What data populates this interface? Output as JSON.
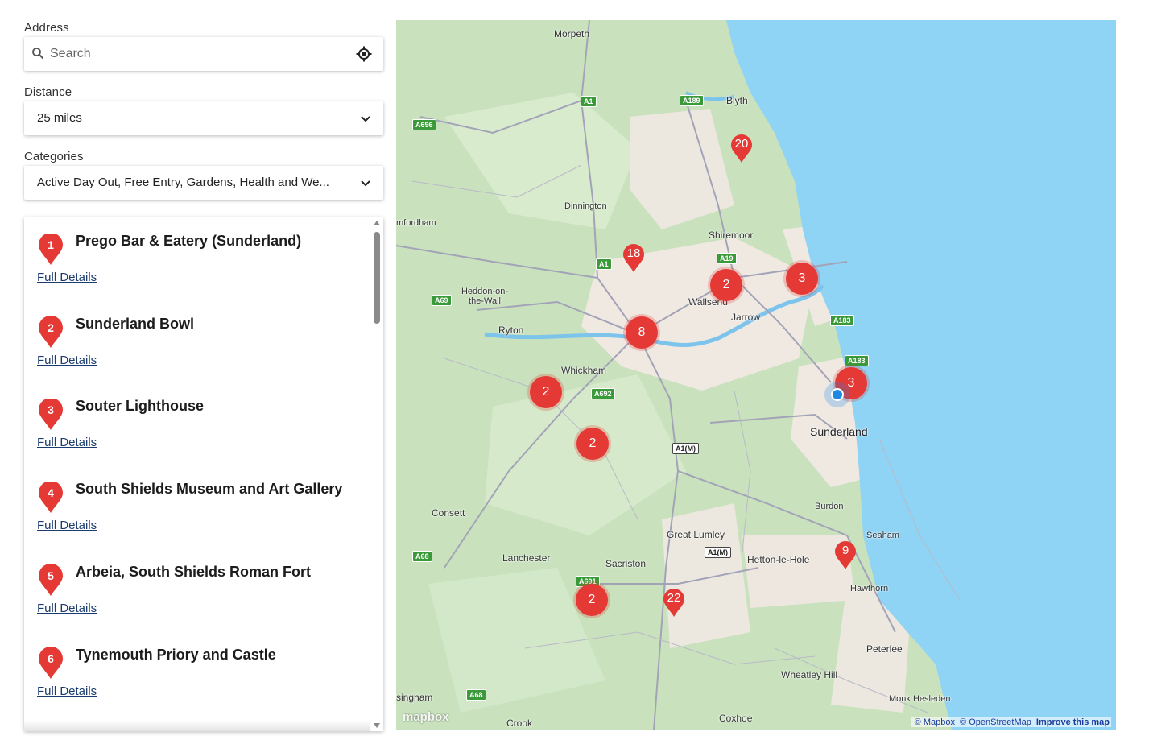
{
  "address": {
    "label": "Address",
    "placeholder": "Search"
  },
  "distance": {
    "label": "Distance",
    "value": "25 miles"
  },
  "categories": {
    "label": "Categories",
    "value": "Active Day Out, Free Entry, Gardens, Health and We..."
  },
  "results": [
    {
      "number": "1",
      "title": "Prego Bar & Eatery (Sunderland)",
      "link": "Full Details"
    },
    {
      "number": "2",
      "title": "Sunderland Bowl",
      "link": "Full Details"
    },
    {
      "number": "3",
      "title": "Souter Lighthouse",
      "link": "Full Details"
    },
    {
      "number": "4",
      "title": "South Shields Museum and Art Gallery",
      "link": "Full Details"
    },
    {
      "number": "5",
      "title": "Arbeia, South Shields Roman Fort",
      "link": "Full Details"
    },
    {
      "number": "6",
      "title": "Tynemouth Priory and Castle",
      "link": "Full Details"
    }
  ],
  "map": {
    "places": [
      "Morpeth",
      "Blyth",
      "Dinnington",
      "Shiremoor",
      "mfordham",
      "Heddon-on-the-Wall",
      "Wallsend",
      "Jarrow",
      "Ryton",
      "Whickham",
      "Sunderland",
      "Consett",
      "Burdon",
      "Great Lumley",
      "Seaham",
      "Lanchester",
      "Sacriston",
      "Hetton-le-Hole",
      "Hawthorn",
      "Peterlee",
      "Wheatley Hill",
      "singham",
      "Crook",
      "Coxhoe",
      "Monk Hesleden"
    ],
    "roads": [
      "A1",
      "A189",
      "A696",
      "A19",
      "A1",
      "A69",
      "A183",
      "A183",
      "A692",
      "A1(M)",
      "A68",
      "A1(M)",
      "A691",
      "A68"
    ],
    "clusters": [
      "2",
      "3",
      "8",
      "2",
      "3",
      "2",
      "2"
    ],
    "pins": [
      "20",
      "18",
      "9",
      "22"
    ],
    "logo": "mapbox",
    "attribution": {
      "mapbox": "© Mapbox",
      "osm": "© OpenStreetMap",
      "improve": "Improve this map"
    }
  },
  "colors": {
    "marker": "#e53935",
    "link": "#1a3c6e",
    "water": "#8fd3f5",
    "location": "#1e88e5"
  }
}
